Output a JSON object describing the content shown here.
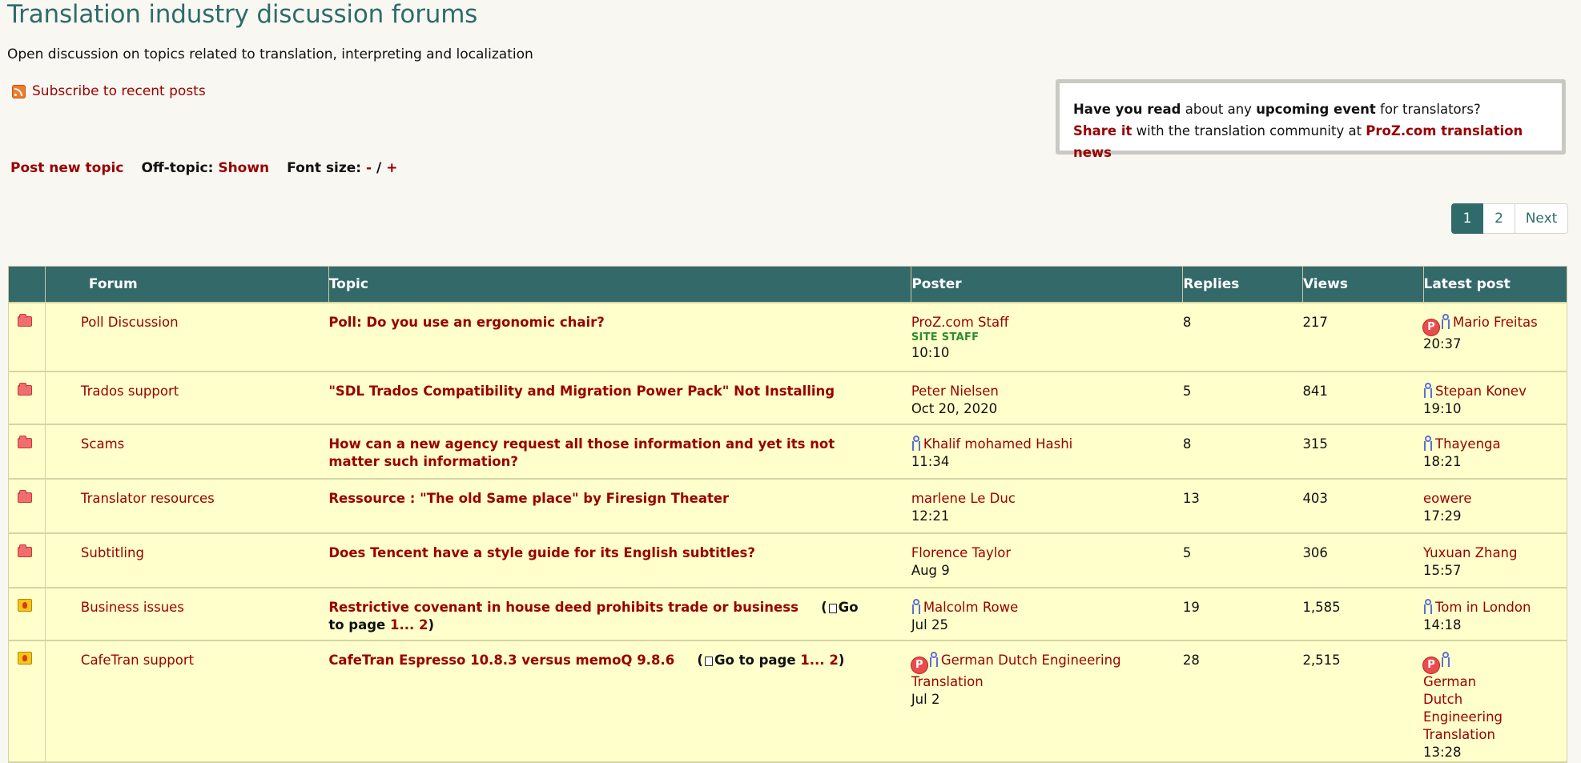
{
  "header": {
    "title": "Translation industry discussion forums",
    "subtitle": "Open discussion on topics related to translation, interpreting and localization"
  },
  "subscribe_label": "Subscribe to recent posts",
  "share_box": {
    "line1_bold1": "Have you read",
    "line1_text1": " about any ",
    "line1_bold2": "upcoming event",
    "line1_text2": " for translators?",
    "line2_link1": "Share it",
    "line2_text": " with the translation community at ",
    "line2_link2": "ProZ.com translation news"
  },
  "toolbar": {
    "post_new_topic": "Post new topic",
    "offtopic_label": "Off-topic:",
    "offtopic_value": "Shown",
    "font_size_label": "Font size:",
    "font_minus": "-",
    "font_sep": "/",
    "font_plus": "+"
  },
  "pagination": {
    "current": "1",
    "page2": "2",
    "next": "Next"
  },
  "table": {
    "columns": {
      "forum": "Forum",
      "topic": "Topic",
      "poster": "Poster",
      "replies": "Replies",
      "views": "Views",
      "latest": "Latest post"
    },
    "rows": [
      {
        "icon": "folder-icon",
        "forum": "Poll Discussion",
        "topic": "Poll: Do you use an ergonomic chair?",
        "poster": "ProZ.com Staff",
        "poster_badge": "SITE STAFF",
        "poster_time": "10:10",
        "replies": "8",
        "views": "217",
        "latest_user": "Mario Freitas",
        "latest_time": "20:37"
      },
      {
        "icon": "folder-icon",
        "forum": "Trados support",
        "topic": "\"SDL Trados Compatibility and Migration Power Pack\" Not Installing",
        "poster": "Peter Nielsen",
        "poster_time": "Oct 20, 2020",
        "replies": "5",
        "views": "841",
        "latest_user": "Stepan Konev",
        "latest_time": "19:10"
      },
      {
        "icon": "folder-icon",
        "forum": "Scams",
        "topic": "How can a new agency request all those information and yet its not matter such information?",
        "poster": "Khalif mohamed Hashi",
        "poster_time": "11:34",
        "replies": "8",
        "views": "315",
        "latest_user": "Thayenga",
        "latest_time": "18:21"
      },
      {
        "icon": "folder-icon",
        "forum": "Translator resources",
        "topic": "Ressource : \"The old Same place\" by Firesign Theater",
        "poster": "marlene Le Duc",
        "poster_time": "12:21",
        "replies": "13",
        "views": "403",
        "latest_user": "eowere",
        "latest_time": "17:29"
      },
      {
        "icon": "folder-icon",
        "forum": "Subtitling",
        "topic": "Does Tencent have a style guide for its English subtitles?",
        "poster": "Florence Taylor",
        "poster_time": "Aug 9",
        "replies": "5",
        "views": "306",
        "latest_user": "Yuxuan Zhang",
        "latest_time": "15:57"
      },
      {
        "icon": "hot-icon",
        "forum": "Business issues",
        "topic": "Restrictive covenant in house deed prohibits trade or business",
        "goto_label": "Go to page",
        "goto_p1": "1...",
        "goto_p2": "2",
        "poster": "Malcolm Rowe",
        "poster_time": "Jul 25",
        "replies": "19",
        "views": "1,585",
        "latest_user": "Tom in London",
        "latest_time": "14:18"
      },
      {
        "icon": "hot-icon",
        "forum": "CafeTran support",
        "topic": "CafeTran Espresso 10.8.3 versus memoQ 9.8.6",
        "goto_label_a": "Go to",
        "goto_label_b": "page",
        "goto_p1": "1...",
        "goto_p2": "2",
        "poster": "German Dutch Engineering Translation",
        "poster_time": "Jul 2",
        "replies": "28",
        "views": "2,515",
        "latest_user": "German Dutch Engineering Translation",
        "latest_time": "13:28"
      }
    ]
  },
  "icons": {
    "pro_badge_letter": "P"
  }
}
